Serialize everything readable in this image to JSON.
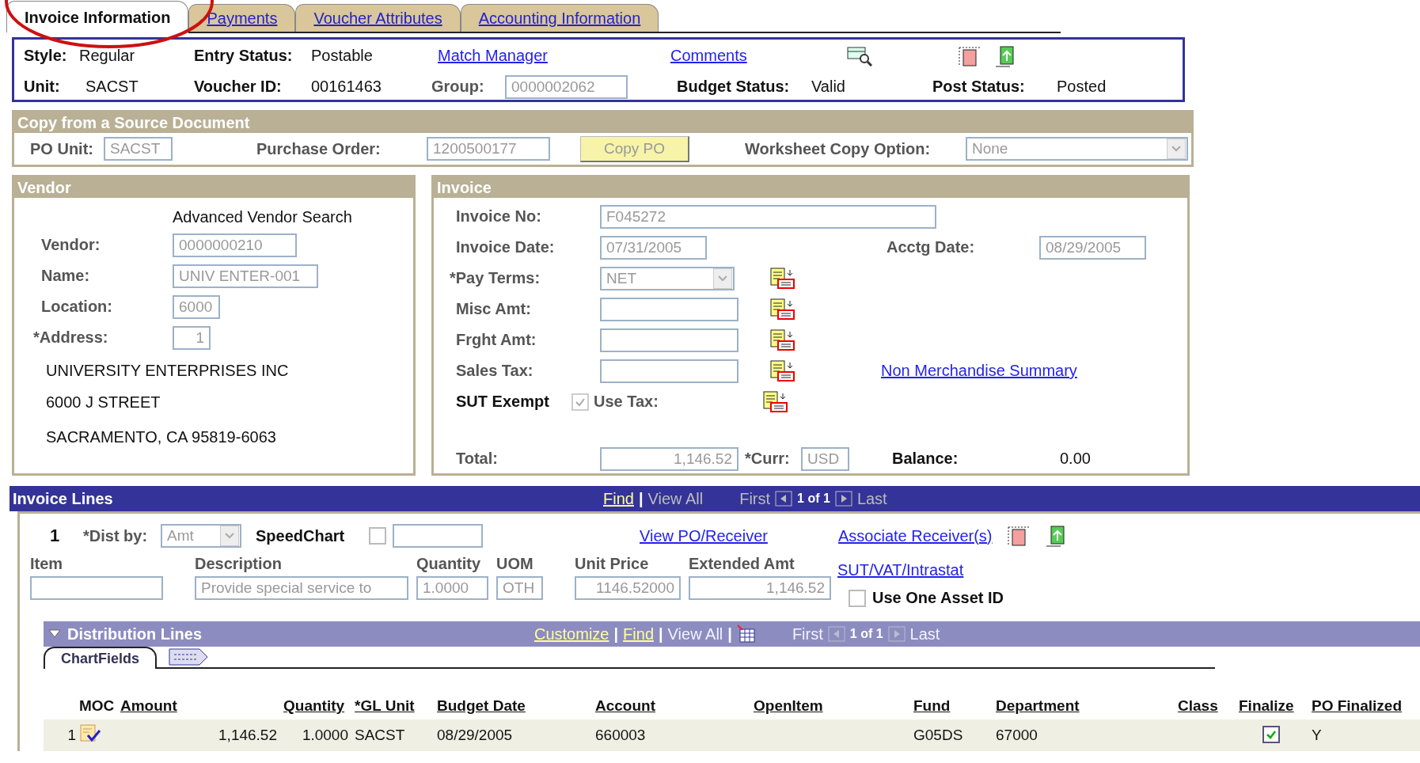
{
  "tabs": [
    {
      "label": "Invoice Information",
      "selected": true,
      "circled": true
    },
    {
      "label": "Payments",
      "selected": false,
      "circled": false
    },
    {
      "label": "Voucher Attributes",
      "selected": false,
      "circled": false
    },
    {
      "label": "Accounting Information",
      "selected": false,
      "circled": false
    }
  ],
  "header": {
    "style_label": "Style:",
    "style": "Regular",
    "entry_status_label": "Entry Status:",
    "entry_status": "Postable",
    "match_manager": "Match Manager",
    "comments": "Comments",
    "unit_label": "Unit:",
    "unit": "SACST",
    "voucher_id_label": "Voucher ID:",
    "voucher_id": "00161463",
    "group_label": "Group:",
    "group": "0000002062",
    "budget_status_label": "Budget Status:",
    "budget_status": "Valid",
    "post_status_label": "Post Status:",
    "post_status": "Posted"
  },
  "copy_source": {
    "title": "Copy from a Source Document",
    "po_unit_label": "PO Unit:",
    "po_unit": "SACST",
    "purchase_order_label": "Purchase Order:",
    "purchase_order": "1200500177",
    "copy_button": "Copy PO",
    "worksheet_label": "Worksheet Copy Option:",
    "worksheet_value": "None"
  },
  "vendor": {
    "title": "Vendor",
    "advanced_search": "Advanced Vendor Search",
    "fields": [
      {
        "label": "Vendor:",
        "value": "0000000210",
        "kind": "text"
      },
      {
        "label": "Name:",
        "value": "UNIV ENTER-001",
        "kind": "text"
      },
      {
        "label": "Location:",
        "value": "6000",
        "kind": "text"
      },
      {
        "label": "*Address:",
        "value": "1",
        "kind": "number"
      }
    ],
    "address_lines": [
      "UNIVERSITY ENTERPRISES INC",
      "6000 J STREET",
      "SACRAMENTO, CA  95819-6063"
    ]
  },
  "invoice": {
    "title": "Invoice",
    "invoice_no": {
      "label": "Invoice No:",
      "value": "F045272"
    },
    "invoice_date": {
      "label": "Invoice Date:",
      "value": "07/31/2005"
    },
    "acctg_date": {
      "label": "Acctg Date:",
      "value": "08/29/2005"
    },
    "pay_terms": {
      "label": "*Pay Terms:",
      "value": "NET"
    },
    "misc_amt": {
      "label": "Misc Amt:"
    },
    "frght_amt": {
      "label": "Frght Amt:"
    },
    "sales_tax": {
      "label": "Sales Tax:"
    },
    "non_merch_link": "Non Merchandise Summary",
    "sut_exempt": {
      "label": "SUT Exempt",
      "checked": true
    },
    "use_tax": {
      "label": "Use Tax:"
    },
    "total": {
      "label": "Total:",
      "value": "1,146.52"
    },
    "currency": {
      "label": "*Curr:",
      "value": "USD"
    },
    "balance": {
      "label": "Balance:",
      "value": "0.00"
    }
  },
  "invoice_lines": {
    "title": "Invoice Lines",
    "nav": {
      "find": "Find",
      "separator": "|",
      "view_all": "View All",
      "first": "First",
      "count": "1 of 1",
      "last": "Last"
    },
    "line_number": "1",
    "dist_by_label": "*Dist by:",
    "dist_by": "Amt",
    "speedchart_label": "SpeedChart",
    "speedchart_checked": false,
    "view_po": "View PO/Receiver",
    "associate": "Associate Receiver(s)",
    "columns": [
      "Item",
      "Description",
      "Quantity",
      "UOM",
      "Unit Price",
      "Extended Amt"
    ],
    "values": {
      "description": "Provide special service to",
      "quantity": "1.0000",
      "uom": "OTH",
      "unit_price": "1146.52000",
      "extended_amt": "1,146.52"
    },
    "sut_link": "SUT/VAT/Intrastat",
    "use_one_asset": {
      "label": "Use One Asset ID",
      "checked": false
    },
    "distribution": {
      "title": "Distribution Lines",
      "expanded": true,
      "nav": {
        "customize": "Customize",
        "separator_1": "|",
        "find": "Find",
        "separator_2": "|",
        "view_all": "View All",
        "separator_3": "|",
        "first": "First",
        "count": "1 of 1",
        "last": "Last"
      },
      "tab": "ChartFields",
      "columns": [
        "MOC",
        "Amount",
        "Quantity",
        "*GL Unit",
        "Budget Date",
        "Account",
        "OpenItem",
        "Fund",
        "Department",
        "Class",
        "Finalize",
        "PO Finalized"
      ],
      "rows": [
        {
          "number": "1",
          "amount": "1,146.52",
          "quantity": "1.0000",
          "gl_unit": "SACST",
          "budget_date": "08/29/2005",
          "account": "660003",
          "fund": "G05DS",
          "department": "67000",
          "finalize": true,
          "po_finalized": "Y"
        }
      ]
    }
  }
}
